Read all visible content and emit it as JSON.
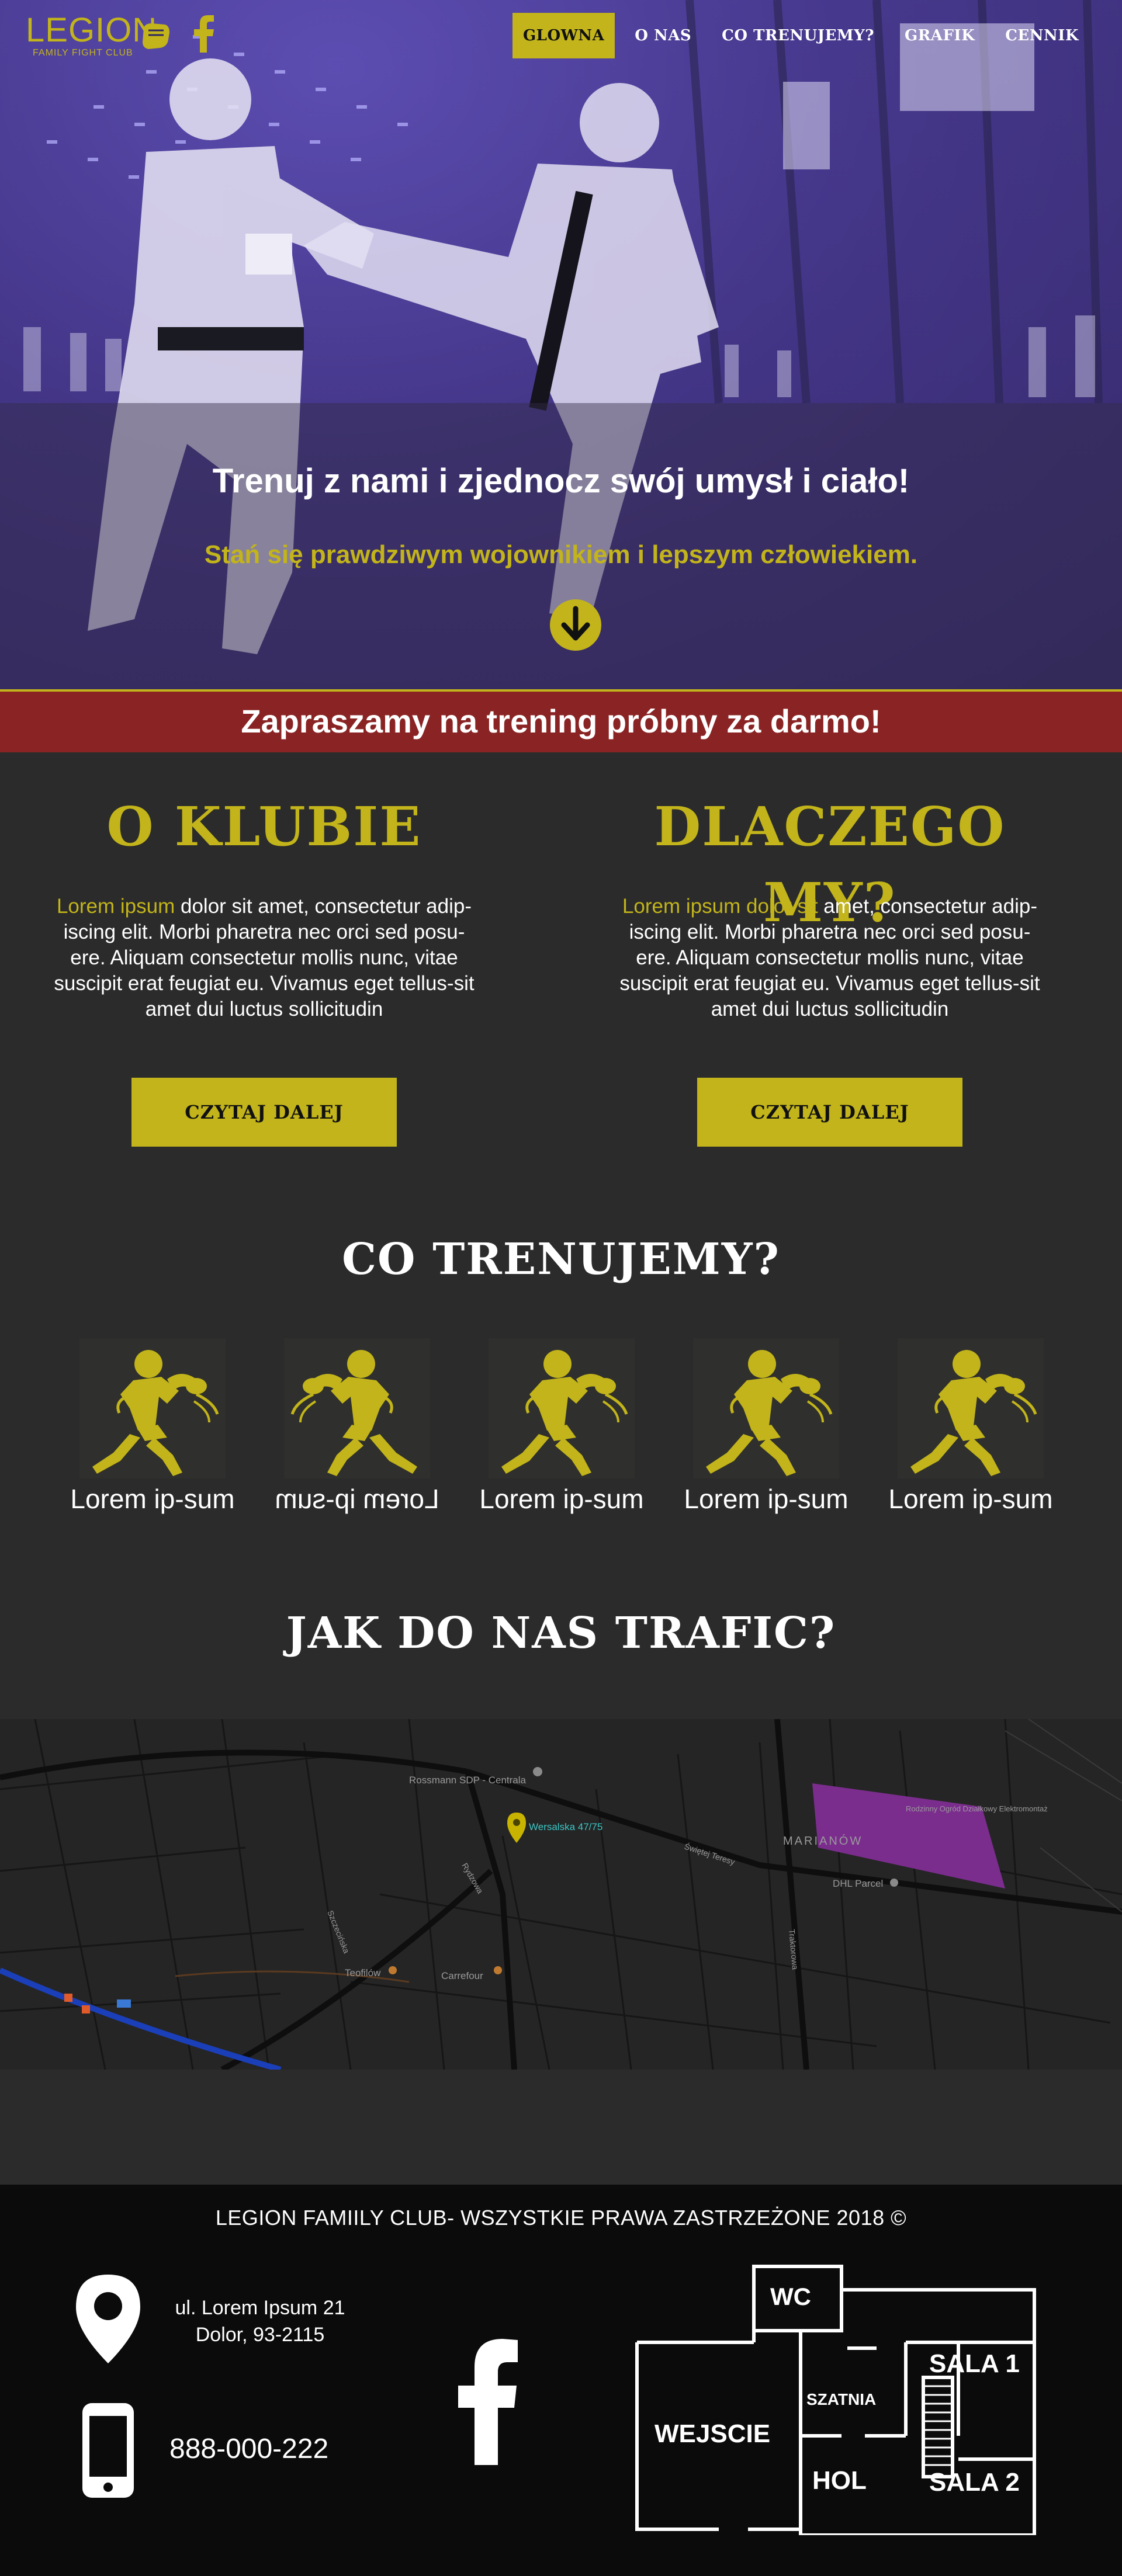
{
  "header": {
    "logo_text": "LEGION",
    "logo_subtitle": "FAMILY FIGHT CLUB",
    "nav": [
      {
        "label": "GLOWNA",
        "active": true
      },
      {
        "label": "O NAS",
        "active": false
      },
      {
        "label": "CO TRENUJEMY?",
        "active": false
      },
      {
        "label": "GRAFIK",
        "active": false
      },
      {
        "label": "CENNIK",
        "active": false
      }
    ],
    "social_icon": "facebook-icon"
  },
  "hero": {
    "title": "Trenuj z nami i zjednocz swój umysł i ciało!",
    "subtitle": "Stań się prawdziwym wojownikiem i lepszym człowiekiem.",
    "arrow_icon": "arrow-down-icon"
  },
  "promo": {
    "text": "Zapraszamy na trening próbny za darmo!"
  },
  "about": {
    "left": {
      "title": "O KLUBIE",
      "highlight": "Lorem ipsum",
      "text": " dolor sit amet, consectetur adip-iscing elit. Morbi pharetra nec orci sed posu-ere. Aliquam consectetur mollis nunc, vitae suscipit erat feugiat eu. Vivamus eget tellus-sit amet dui luctus sollicitudin",
      "button": "CZYTAJ DALEJ"
    },
    "right": {
      "title": "DLACZEGO MY?",
      "highlight": "Lorem ipsum dolor sit",
      "text": " amet, consectetur adip-iscing elit. Morbi pharetra nec orci sed posu-ere. Aliquam consectetur mollis nunc, vitae suscipit erat feugiat eu. Vivamus eget tellus-sit amet dui luctus sollicitudin",
      "button": "CZYTAJ DALEJ"
    }
  },
  "training": {
    "title": "CO TRENUJEMY?",
    "items": [
      {
        "label": "Lorem ip-sum",
        "mirrored": false
      },
      {
        "label": "Lorem ip-sum",
        "mirrored": true
      },
      {
        "label": "Lorem ip-sum",
        "mirrored": false
      },
      {
        "label": "Lorem ip-sum",
        "mirrored": false
      },
      {
        "label": "Lorem ip-sum",
        "mirrored": false
      }
    ],
    "icon": "boxer-icon"
  },
  "location": {
    "title": "JAK DO NAS TRAFIC?",
    "map_labels": {
      "pin": "Wersalska 47/75",
      "shop1": "Rossmann SDP - Centrala",
      "district": "MARIANÓW",
      "parcel": "DHL Parcel",
      "garden": "Rodzinny Ogród Działkowy Elektromontaż",
      "shop2": "Carrefour",
      "place": "Teofilów",
      "street1": "Szczecińska",
      "street2": "Rydzowa",
      "street3": "Traktorowa",
      "street4": "Świętej Teresy"
    },
    "colors": {
      "park": "#7b2d8e",
      "pin": "#c8b400",
      "railway": "#1b3fb0"
    }
  },
  "footer": {
    "copyright": "LEGION FAMIILY CLUB- WSZYSTKIE PRAWA ZASTRZEŻONE 2018 ©",
    "address_line1": "ul. Lorem Ipsum 21",
    "address_line2": "Dolor, 93-2115",
    "phone": "888-000-222",
    "floorplan": {
      "wc": "WC",
      "sala1": "SALA 1",
      "szatnia": "SZATNIA",
      "wejscie": "WEJSCIE",
      "hol": "HOL",
      "sala2": "SALA 2"
    }
  },
  "colors": {
    "accent": "#c2b41a",
    "promo": "#8a2424",
    "background": "#2b2b2b",
    "footer": "#0b0b0b"
  }
}
